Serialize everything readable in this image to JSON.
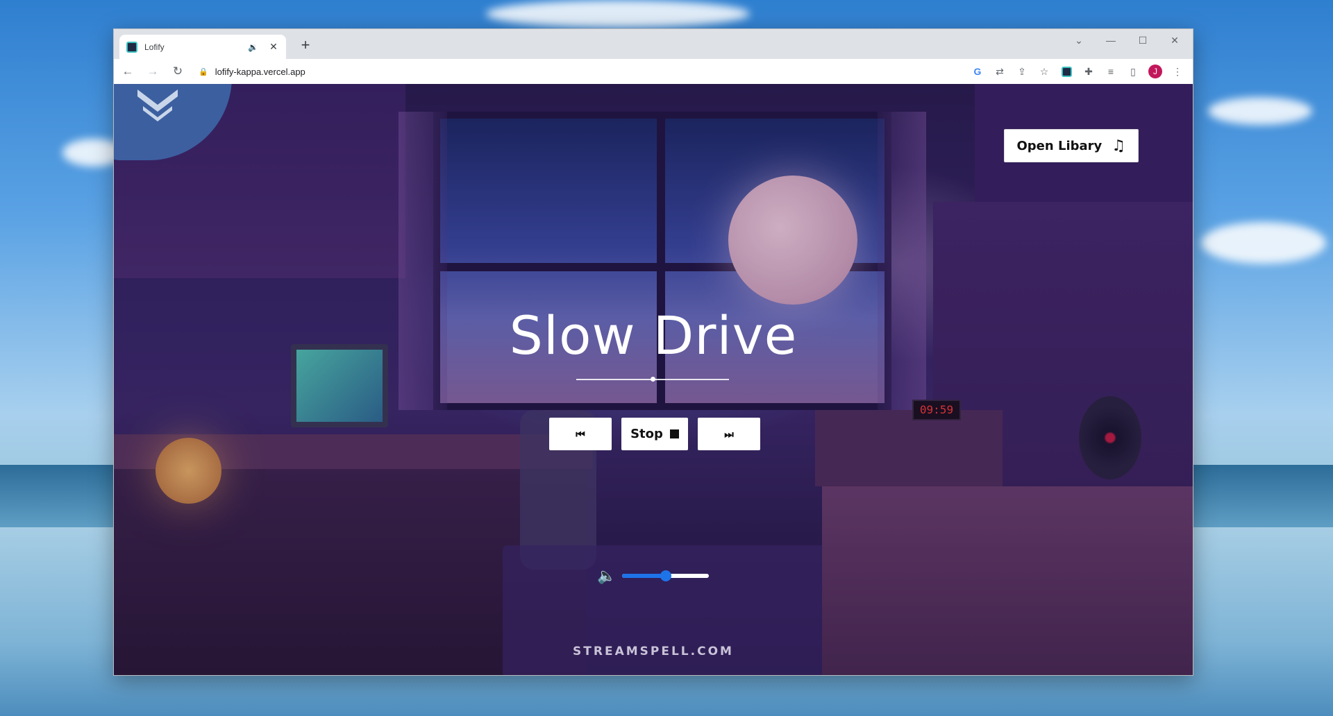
{
  "browser": {
    "tab_title": "Lofify",
    "url": "lofify-kappa.vercel.app",
    "profile_initial": "J"
  },
  "icons": {
    "back": "back-arrow-icon",
    "forward": "forward-arrow-icon",
    "reload": "reload-icon",
    "lock": "lock-icon",
    "speaker": "speaker-icon",
    "music": "music-note-icon"
  },
  "player": {
    "open_library_label": "Open Libary",
    "song_title": "Slow Drive",
    "progress": 0.5,
    "stop_label": "Stop",
    "volume": 0.5
  },
  "footer": {
    "brand": "STREAMSPELL.COM"
  },
  "colors": {
    "accent": "#1e73e8",
    "avatar": "#c2185b"
  }
}
